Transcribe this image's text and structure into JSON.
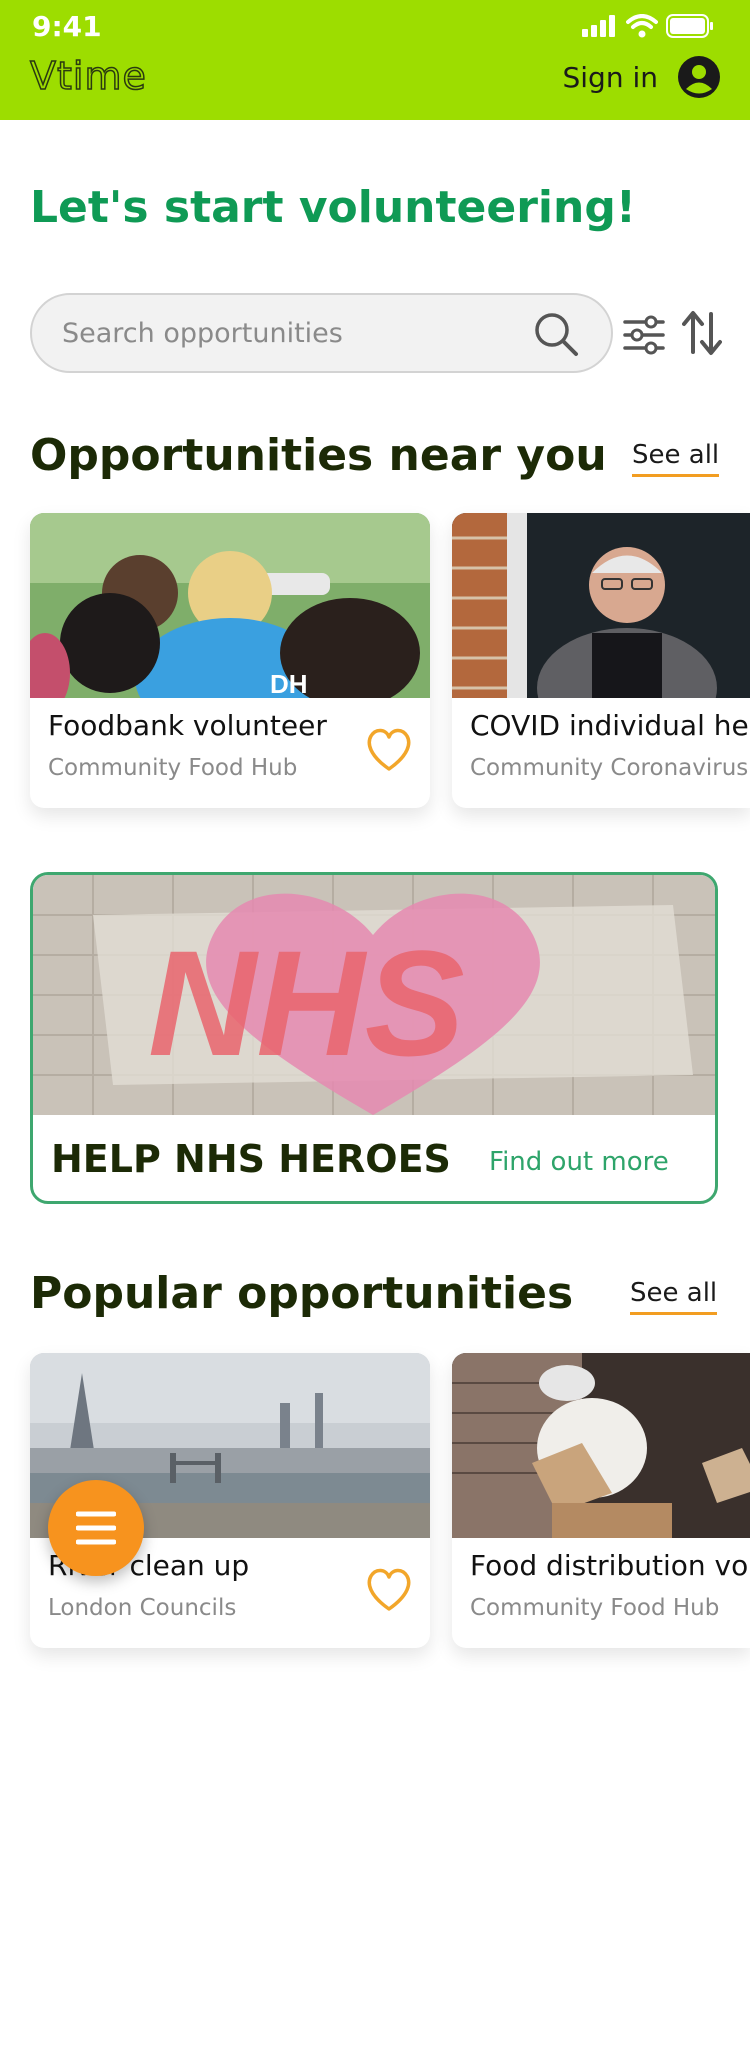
{
  "status_bar": {
    "time": "9:41"
  },
  "header": {
    "logo": "Vtime",
    "sign_in_label": "Sign in"
  },
  "headline": "Let's start volunteering!",
  "search": {
    "placeholder": "Search opportunities"
  },
  "sections": {
    "near_you": {
      "title": "Opportunities near you",
      "see_all": "See all",
      "cards": [
        {
          "title": "Foodbank volunteer",
          "org": "Community Food Hub"
        },
        {
          "title": "COVID individual help",
          "org": "Community Coronavirus Support"
        }
      ]
    },
    "popular": {
      "title": "Popular opportunities",
      "see_all": "See all",
      "cards": [
        {
          "title": "River clean up",
          "org": "London Councils"
        },
        {
          "title": "Food distribution volunteer",
          "org": "Community Food Hub"
        }
      ]
    }
  },
  "banner": {
    "title": "HELP NHS HEROES",
    "link": "Find out more",
    "image_text": "NHS"
  },
  "colors": {
    "header_bg": "#9ddd00",
    "headline": "#0f9a55",
    "accent_orange": "#f7931e",
    "banner_border": "#3ea76f",
    "heart": "#f2a62a"
  },
  "icons": [
    "signal-icon",
    "wifi-icon",
    "battery-icon",
    "account-icon",
    "search-icon",
    "filter-icon",
    "sort-icon",
    "heart-icon",
    "menu-icon"
  ]
}
